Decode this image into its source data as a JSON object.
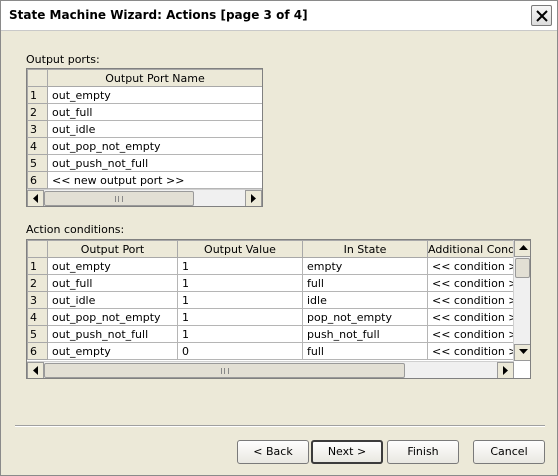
{
  "window": {
    "title": "State Machine Wizard: Actions [page 3  of 4]"
  },
  "output_ports": {
    "group_label": "Output ports:",
    "column_header": "Output Port Name",
    "rows": [
      {
        "num": "1",
        "name": "out_empty"
      },
      {
        "num": "2",
        "name": "out_full"
      },
      {
        "num": "3",
        "name": "out_idle"
      },
      {
        "num": "4",
        "name": "out_pop_not_empty"
      },
      {
        "num": "5",
        "name": "out_push_not_full"
      },
      {
        "num": "6",
        "name": "<< new output port >>"
      }
    ],
    "scroll_grip": "III"
  },
  "action_conditions": {
    "group_label": "Action conditions:",
    "columns": [
      "Output Port",
      "Output Value",
      "In State",
      "Additional Cond"
    ],
    "rows": [
      {
        "num": "1",
        "port": "out_empty",
        "value": "1",
        "state": "empty",
        "cond": "<< condition >>"
      },
      {
        "num": "2",
        "port": "out_full",
        "value": "1",
        "state": "full",
        "cond": "<< condition >>"
      },
      {
        "num": "3",
        "port": "out_idle",
        "value": "1",
        "state": "idle",
        "cond": "<< condition >>"
      },
      {
        "num": "4",
        "port": "out_pop_not_empty",
        "value": "1",
        "state": "pop_not_empty",
        "cond": "<< condition >>"
      },
      {
        "num": "5",
        "port": "out_push_not_full",
        "value": "1",
        "state": "push_not_full",
        "cond": "<< condition >>"
      },
      {
        "num": "6",
        "port": "out_empty",
        "value": "0",
        "state": "full",
        "cond": "<< condition >>"
      }
    ],
    "scroll_grip": "III"
  },
  "buttons": {
    "back": "< Back",
    "next": "Next >",
    "finish": "Finish",
    "cancel": "Cancel"
  }
}
